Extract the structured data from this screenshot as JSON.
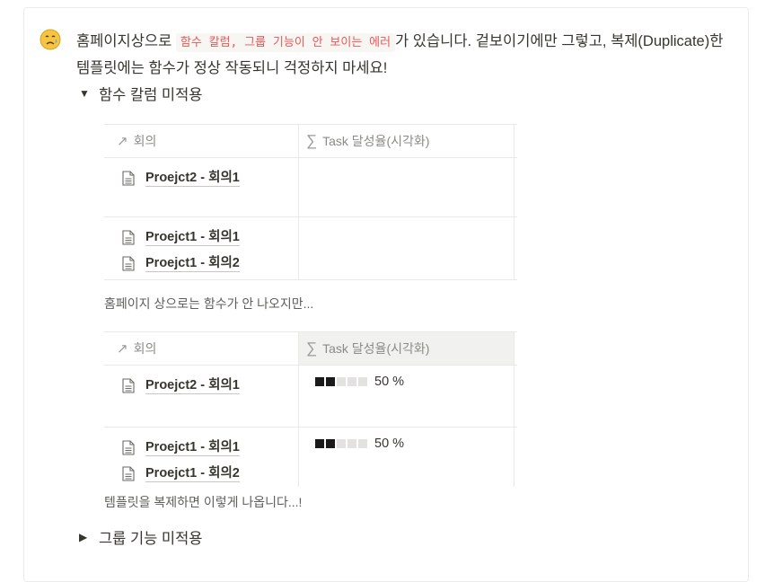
{
  "callout": {
    "emoji": "sad-face-emoji",
    "text_before": "홈페이지상으로 ",
    "code": "함수 칼럼, 그룹 기능이 안 보이는 에러",
    "text_after": "가 있습니다. 겉보이기에만 그렇고, 복제(Duplicate)한 템플릿에는 함수가 정상 작동되니 걱정하지 마세요!"
  },
  "toggle1": {
    "arrow": "▼",
    "label": "함수 칼럼 미적용"
  },
  "table1": {
    "col1": "회의",
    "col2": "Task 달성율(시각화)",
    "rows": [
      {
        "pages": [
          "Proejct2 - 회의1"
        ]
      },
      {
        "pages": [
          "Proejct1 - 회의1",
          "Proejct1 - 회의2"
        ]
      }
    ]
  },
  "caption1": "홈페이지 상으로는 함수가 안 나오지만...",
  "table2": {
    "col1": "회의",
    "col2": "Task 달성율(시각화)",
    "rows": [
      {
        "pages": [
          "Proejct2 - 회의1"
        ],
        "progress": "50 %",
        "progress_value": 0.5
      },
      {
        "pages": [
          "Proejct1 - 회의1",
          "Proejct1 - 회의2"
        ],
        "progress": "50 %",
        "progress_value": 0.5
      }
    ]
  },
  "caption2": "템플릿을 복제하면 이렇게 나옵니다...!",
  "toggle2": {
    "arrow": "▶",
    "label": "그룹 기능 미적용"
  },
  "colors": {
    "text": "#37352f",
    "code_text": "#eb5757",
    "code_bg": "#f7f6f3",
    "border": "#e9e9e7"
  }
}
